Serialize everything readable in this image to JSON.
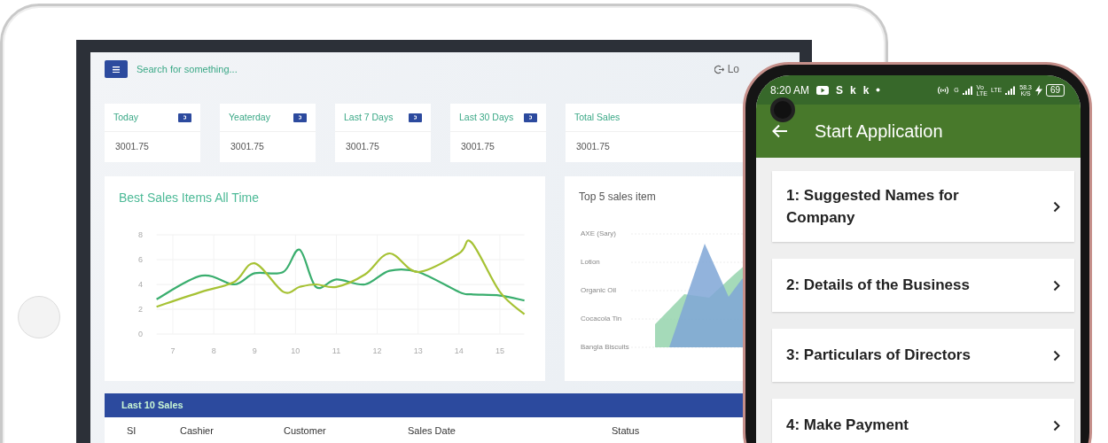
{
  "tablet": {
    "dashboard": {
      "search": {
        "placeholder": "Search for something..."
      },
      "logout": "Lo",
      "stat_cards": [
        {
          "label": "Today",
          "value": "3001.75",
          "badge": true
        },
        {
          "label": "Yeaterday",
          "value": "3001.75",
          "badge": true
        },
        {
          "label": "Last 7 Days",
          "value": "3001.75",
          "badge": true
        },
        {
          "label": "Last 30 Days",
          "value": "3001.75",
          "badge": true
        },
        {
          "label": "Total Sales",
          "value": "3001.75",
          "badge": false
        }
      ],
      "best_sales": {
        "title": "Best Sales Items All Time",
        "chart_data": {
          "type": "line",
          "x": [
            6.6,
            7.7,
            8.5,
            9.0,
            9.7,
            10.1,
            10.5,
            11.0,
            11.7,
            12.3,
            13.0,
            14.0,
            14.3,
            15.0,
            15.6
          ],
          "series": [
            {
              "color": "#3aae6e",
              "values": [
                2.8,
                4.7,
                4.0,
                4.9,
                5.0,
                6.8,
                3.8,
                4.4,
                4.0,
                5.1,
                5.0,
                3.4,
                3.2,
                3.1,
                2.7
              ]
            },
            {
              "color": "#a6c234",
              "values": [
                2.2,
                3.4,
                4.2,
                5.7,
                3.4,
                3.8,
                4.0,
                3.8,
                4.8,
                6.5,
                5.0,
                6.5,
                7.4,
                3.4,
                1.6
              ]
            }
          ],
          "xticks": [
            7,
            8,
            9,
            10,
            11,
            12,
            13,
            14,
            15
          ],
          "yticks": [
            0,
            2,
            4,
            6,
            8
          ],
          "xlim": [
            6.6,
            15.6
          ],
          "ylim": [
            0,
            8
          ],
          "grid": true
        }
      },
      "top_items": {
        "title": "Top 5 sales item",
        "labels": [
          "AXE (Sary)",
          "Lotion",
          "Organic Oil",
          "Cocacola Tin",
          "Bangla Biscuits"
        ]
      },
      "last_sales": {
        "title": "Last 10 Sales",
        "columns": [
          "SI",
          "Cashier",
          "Customer",
          "Sales Date",
          "Status"
        ]
      }
    }
  },
  "phone": {
    "status_bar": {
      "time": "8:20 AM",
      "app_letters": [
        "S",
        "k",
        "k"
      ],
      "g": "G",
      "volte_top": "Vo",
      "volte_bottom": "LTE",
      "lte": "LTE",
      "speed": "58.3",
      "speed_unit": "K/S",
      "battery": "69"
    },
    "app_bar": {
      "title": "Start Application"
    },
    "steps": [
      {
        "label": "1: Suggested Names for Company"
      },
      {
        "label": "2: Details of the Business"
      },
      {
        "label": "3: Particulars of Directors"
      },
      {
        "label": "4: Make Payment"
      }
    ]
  }
}
